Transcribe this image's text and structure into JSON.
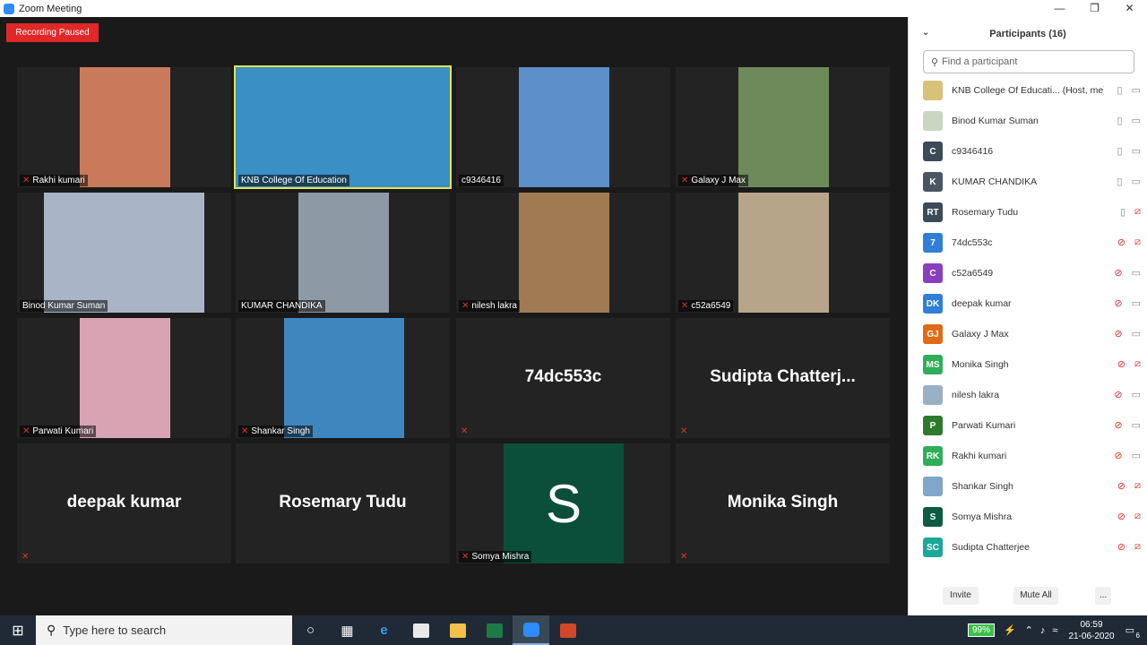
{
  "window": {
    "title": "Zoom Meeting",
    "minimize": "—",
    "maximize": "❐",
    "close": "✕"
  },
  "recording": {
    "label": "Recording Paused",
    "color": "#e02828"
  },
  "tiles": [
    {
      "name": "Rakhi kumari",
      "muted": true,
      "type": "video"
    },
    {
      "name": "KNB College Of Education",
      "muted": false,
      "type": "video",
      "active": true
    },
    {
      "name": "c9346416",
      "muted": false,
      "type": "video"
    },
    {
      "name": "Galaxy J Max",
      "muted": true,
      "type": "video"
    },
    {
      "name": "Binod Kumar Suman",
      "muted": false,
      "type": "video"
    },
    {
      "name": "KUMAR CHANDIKA",
      "muted": false,
      "type": "video"
    },
    {
      "name": "nilesh lakra",
      "muted": true,
      "type": "video"
    },
    {
      "name": "c52a6549",
      "muted": true,
      "type": "video"
    },
    {
      "name": "Parwati Kumari",
      "muted": true,
      "type": "video"
    },
    {
      "name": "Shankar Singh",
      "muted": true,
      "type": "video"
    },
    {
      "name": "74dc553c",
      "muted": true,
      "type": "name"
    },
    {
      "name": "Sudipta  Chatterj...",
      "muted": true,
      "type": "name"
    },
    {
      "name": "deepak kumar",
      "muted": true,
      "type": "name"
    },
    {
      "name": "Rosemary Tudu",
      "muted": false,
      "type": "name"
    },
    {
      "name": "Somya Mishra",
      "muted": true,
      "type": "letter",
      "letter": "S"
    },
    {
      "name": "Monika Singh",
      "muted": true,
      "type": "name"
    }
  ],
  "panel": {
    "title": "Participants (16)",
    "search_placeholder": "Find a participant",
    "participants": [
      {
        "name": "KNB College Of Educati...",
        "role": "(Host, me)",
        "initials": "",
        "color": "#d8c27a",
        "mic": "on",
        "cam": "on"
      },
      {
        "name": "Binod Kumar Suman",
        "role": "",
        "initials": "",
        "color": "#c9d6c2",
        "mic": "on",
        "cam": "on"
      },
      {
        "name": "c9346416",
        "role": "",
        "initials": "C",
        "color": "#3c4a5a",
        "mic": "on",
        "cam": "on"
      },
      {
        "name": "KUMAR CHANDIKA",
        "role": "",
        "initials": "K",
        "color": "#4a5663",
        "mic": "on",
        "cam": "on"
      },
      {
        "name": "Rosemary Tudu",
        "role": "",
        "initials": "RT",
        "color": "#3c4a5a",
        "mic": "on",
        "cam": "off"
      },
      {
        "name": "74dc553c",
        "role": "",
        "initials": "7",
        "color": "#2f7fd6",
        "mic": "off",
        "cam": "off"
      },
      {
        "name": "c52a6549",
        "role": "",
        "initials": "C",
        "color": "#8a3fbf",
        "mic": "off",
        "cam": "on"
      },
      {
        "name": "deepak kumar",
        "role": "",
        "initials": "DK",
        "color": "#2f7fd6",
        "mic": "off",
        "cam": "on"
      },
      {
        "name": "Galaxy J Max",
        "role": "",
        "initials": "GJ",
        "color": "#e06a16",
        "mic": "off",
        "cam": "on"
      },
      {
        "name": "Monika Singh",
        "role": "",
        "initials": "MS",
        "color": "#2fae5a",
        "mic": "off",
        "cam": "off"
      },
      {
        "name": "nilesh lakra",
        "role": "",
        "initials": "",
        "color": "#9ab0c4",
        "mic": "off",
        "cam": "on"
      },
      {
        "name": "Parwati Kumari",
        "role": "",
        "initials": "P",
        "color": "#2d7a2d",
        "mic": "off",
        "cam": "on"
      },
      {
        "name": "Rakhi kumari",
        "role": "",
        "initials": "RK",
        "color": "#2fae5a",
        "mic": "off",
        "cam": "on"
      },
      {
        "name": "Shankar Singh",
        "role": "",
        "initials": "",
        "color": "#7fa7c9",
        "mic": "off",
        "cam": "off"
      },
      {
        "name": "Somya Mishra",
        "role": "",
        "initials": "S",
        "color": "#0b5c42",
        "mic": "off",
        "cam": "off"
      },
      {
        "name": "Sudipta Chatterjee",
        "role": "",
        "initials": "SC",
        "color": "#1aa89a",
        "mic": "off",
        "cam": "off"
      }
    ],
    "invite": "Invite",
    "mute_all": "Mute All",
    "more": "..."
  },
  "taskbar": {
    "search_placeholder": "Type here to search",
    "battery": "99%",
    "time": "06:59",
    "date": "21-06-2020",
    "notifications": "6"
  }
}
